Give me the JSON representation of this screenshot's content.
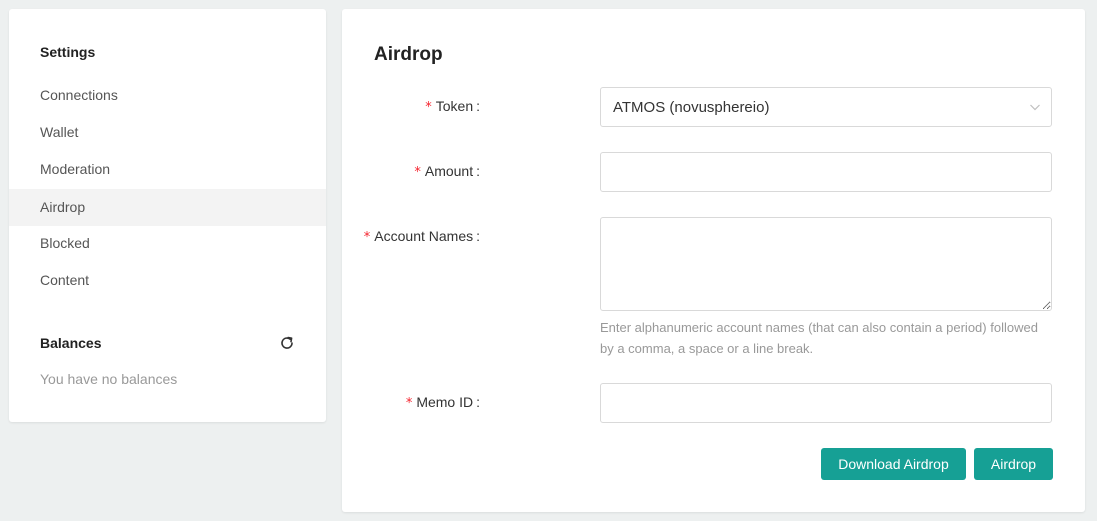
{
  "sidebar": {
    "settings_heading": "Settings",
    "items": [
      {
        "label": "Connections"
      },
      {
        "label": "Wallet"
      },
      {
        "label": "Moderation"
      },
      {
        "label": "Airdrop",
        "active": true
      },
      {
        "label": "Blocked"
      },
      {
        "label": "Content"
      }
    ],
    "balances_heading": "Balances",
    "refresh_icon": "refresh-icon",
    "no_balances_text": "You have no balances"
  },
  "form": {
    "title": "Airdrop",
    "required_mark": "*",
    "colon": ":",
    "token": {
      "label": "Token",
      "value": "ATMOS (novusphereio)"
    },
    "amount": {
      "label": "Amount",
      "value": ""
    },
    "account_names": {
      "label": "Account Names",
      "value": "",
      "help": "Enter alphanumeric account names (that can also contain a period) followed by a comma, a space or a line break."
    },
    "memo_id": {
      "label": "Memo ID",
      "value": ""
    },
    "download_button": "Download Airdrop",
    "airdrop_button": "Airdrop"
  },
  "colors": {
    "accent": "#16a095",
    "required": "#f5222d",
    "active_nav_bg": "#f3f3f3",
    "page_bg": "#edf0f0"
  }
}
